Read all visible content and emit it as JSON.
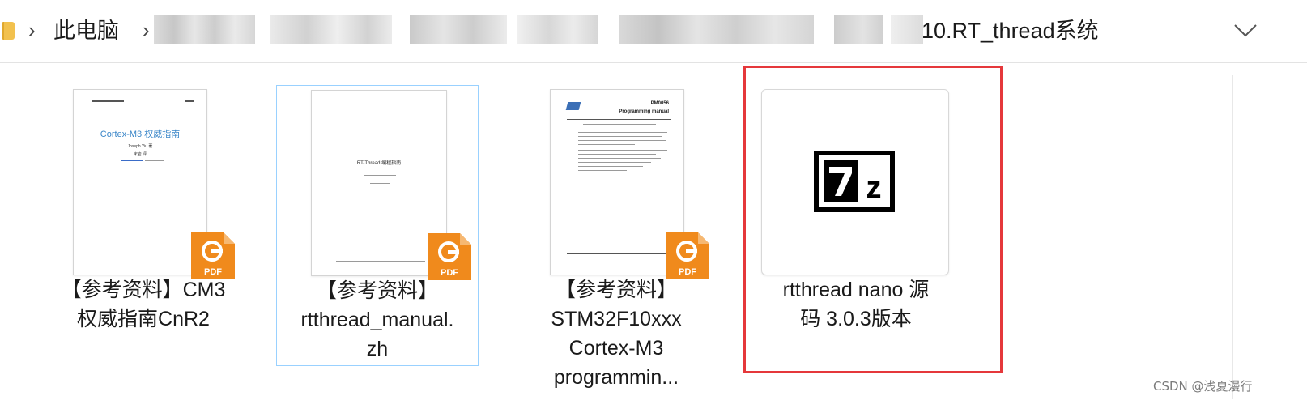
{
  "address_bar": {
    "this_pc": "此电脑",
    "current_folder": "10.RT_thread系统"
  },
  "files": [
    {
      "name": "【参考资料】CM3\n权威指南CnR2",
      "type": "pdf",
      "thumb": {
        "title": "Cortex-M3 权威指南",
        "author": "Joseph Yiu 著",
        "translator": "宋岩 译"
      }
    },
    {
      "name": "【参考资料】\nrtthread_manual.\nzh",
      "type": "pdf",
      "thumb": {
        "title": "RT-Thread 编程指南"
      }
    },
    {
      "name": "【参考资料】\nSTM32F10xxx\nCortex-M3\nprogrammin...",
      "type": "pdf",
      "thumb": {
        "code": "PM0056",
        "title": "Programming manual"
      }
    },
    {
      "name": "rtthread nano 源\n码 3.0.3版本",
      "type": "7z",
      "thumb": {
        "logo": "7z"
      }
    }
  ],
  "icons": {
    "folder": "folder-icon",
    "pdf_badge": "foxit-pdf-icon",
    "archive": "7zip-icon"
  },
  "colors": {
    "highlight": "#e5383b",
    "selection_border": "#99d1ff",
    "pdf_orange": "#f08a1c"
  },
  "watermark": "CSDN @浅夏漫行"
}
